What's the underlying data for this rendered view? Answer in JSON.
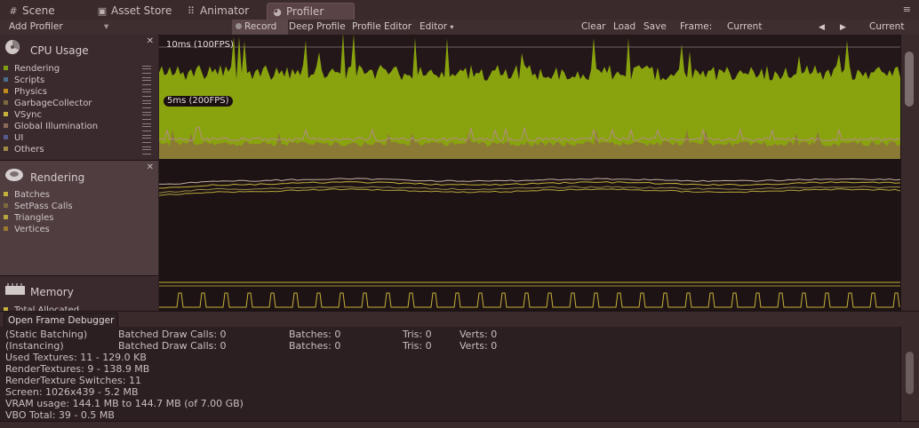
{
  "tabs": [
    {
      "label": "Scene",
      "icon": "scene-hash-icon"
    },
    {
      "label": "Asset Store",
      "icon": "shopping-bag-icon"
    },
    {
      "label": "Animator",
      "icon": "animator-grid-icon"
    },
    {
      "label": "Profiler",
      "icon": "profiler-icon",
      "active": true
    }
  ],
  "toolbar": {
    "add_profiler": "Add Profiler",
    "record": "Record",
    "deep_profile": "Deep Profile",
    "profile_editor": "Profile Editor",
    "editor": "Editor",
    "clear": "Clear",
    "load": "Load",
    "save": "Save",
    "frame_label": "Frame:",
    "frame_value": "Current",
    "current": "Current"
  },
  "modules": {
    "cpu": {
      "title": "CPU Usage",
      "items": [
        {
          "label": "Rendering",
          "color": "#7f9e12"
        },
        {
          "label": "Scripts",
          "color": "#4a6d8c"
        },
        {
          "label": "Physics",
          "color": "#c28b1a"
        },
        {
          "label": "GarbageCollector",
          "color": "#7a6a3e"
        },
        {
          "label": "VSync",
          "color": "#c6b23b"
        },
        {
          "label": "Global Illumination",
          "color": "#8a6b5a"
        },
        {
          "label": "UI",
          "color": "#555b8c"
        },
        {
          "label": "Others",
          "color": "#a08a46"
        }
      ]
    },
    "rendering": {
      "title": "Rendering",
      "items": [
        {
          "label": "Batches",
          "color": "#c6b23b"
        },
        {
          "label": "SetPass Calls",
          "color": "#7a6a3e"
        },
        {
          "label": "Triangles",
          "color": "#b5a53c"
        },
        {
          "label": "Vertices",
          "color": "#9b7a2e"
        }
      ]
    },
    "memory": {
      "title": "Memory",
      "items": [
        {
          "label": "Total Allocated",
          "color": "#c6b23b"
        }
      ]
    }
  },
  "graph": {
    "label_top": "10ms (100FPS)",
    "label_mid": "5ms (200FPS)",
    "cpu_color": "#89a30f",
    "others_color": "#8b7a36"
  },
  "detail": {
    "open_frame_debugger": "Open Frame Debugger",
    "rows": [
      {
        "name": "(Static Batching)",
        "draw_calls": "Batched Draw Calls: 0",
        "batches": "Batches: 0",
        "tris": "Tris: 0",
        "verts": "Verts: 0"
      },
      {
        "name": "(Instancing)",
        "draw_calls": "Batched Draw Calls: 0",
        "batches": "Batches: 0",
        "tris": "Tris: 0",
        "verts": "Verts: 0"
      }
    ],
    "lines": [
      "Used Textures: 11 - 129.0 KB",
      "RenderTextures: 9 - 138.9 MB",
      "RenderTexture Switches: 11",
      "Screen: 1026x439 - 5.2 MB",
      "VRAM usage: 144.1 MB to 144.7 MB (of 7.00 GB)",
      "VBO Total: 39 - 0.5 MB"
    ]
  }
}
